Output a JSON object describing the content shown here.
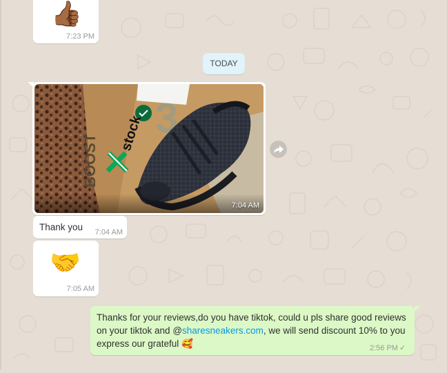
{
  "messages": {
    "thumbs": {
      "emoji": "👍🏾",
      "time": "7:23 PM"
    },
    "date_divider": "TODAY",
    "photo": {
      "time": "7:04 AM",
      "box_brand": "stockX",
      "box_text": "BOOST"
    },
    "thank_you": {
      "text": "Thank you",
      "time": "7:04 AM"
    },
    "handshake": {
      "emoji": "🤝",
      "time": "7:05 AM"
    },
    "outgoing": {
      "text_before": "Thanks for your reviews,do you have tiktok, could u pls share good reviews on your tiktok and @",
      "link_text": "sharesneakers.com",
      "text_after": ", we will send discount 10% to you express our grateful ",
      "emoji": "🥰",
      "time": "2:56 PM",
      "status_icon": "✓"
    }
  },
  "colors": {
    "chat_background": "#e6ded5",
    "incoming_bubble": "#ffffff",
    "outgoing_bubble": "#dcf8c6",
    "date_chip": "#e1f3fb",
    "link": "#039be5"
  },
  "icons": {
    "forward": "forward-arrow-icon"
  }
}
